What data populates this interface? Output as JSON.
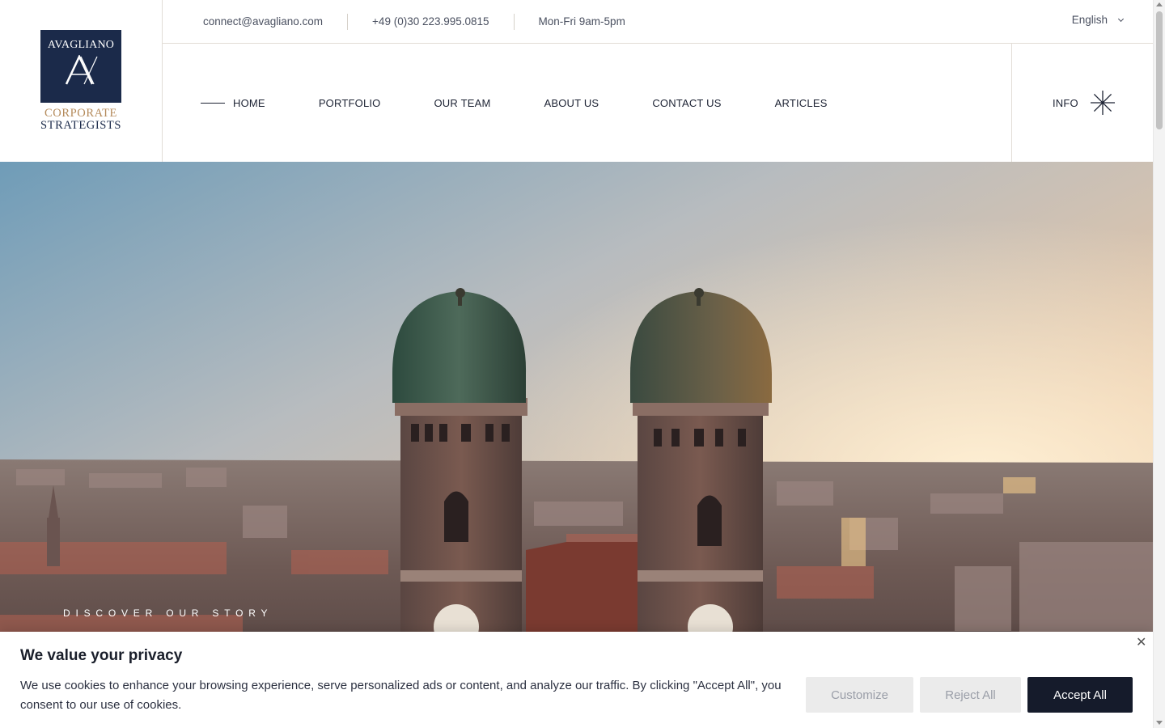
{
  "brand": {
    "name": "AVAGLIANO",
    "line1": "CORPORATE",
    "line2": "STRATEGISTS",
    "navy": "#1b2a4a",
    "gold": "#b48a5a"
  },
  "topbar": {
    "email": "connect@avagliano.com",
    "phone": "+49 (0)30 223.995.0815",
    "hours": "Mon-Fri 9am-5pm",
    "language": "English"
  },
  "nav": {
    "items": [
      {
        "label": "HOME",
        "active": true
      },
      {
        "label": "PORTFOLIO"
      },
      {
        "label": "OUR TEAM"
      },
      {
        "label": "ABOUT US"
      },
      {
        "label": "CONTACT US"
      },
      {
        "label": "ARTICLES"
      }
    ],
    "info_label": "INFO",
    "info_icon": "asterisk-star-icon"
  },
  "hero": {
    "caption": "DISCOVER OUR STORY",
    "image": "munich-frauenkirche-sunset"
  },
  "cookie": {
    "title": "We value your privacy",
    "text": "We use cookies to enhance your browsing experience, serve personalized ads or content, and analyze our traffic. By clicking \"Accept All\", you consent to our use of cookies.",
    "customize": "Customize",
    "reject": "Reject All",
    "accept": "Accept All",
    "close_icon": "close-icon"
  }
}
